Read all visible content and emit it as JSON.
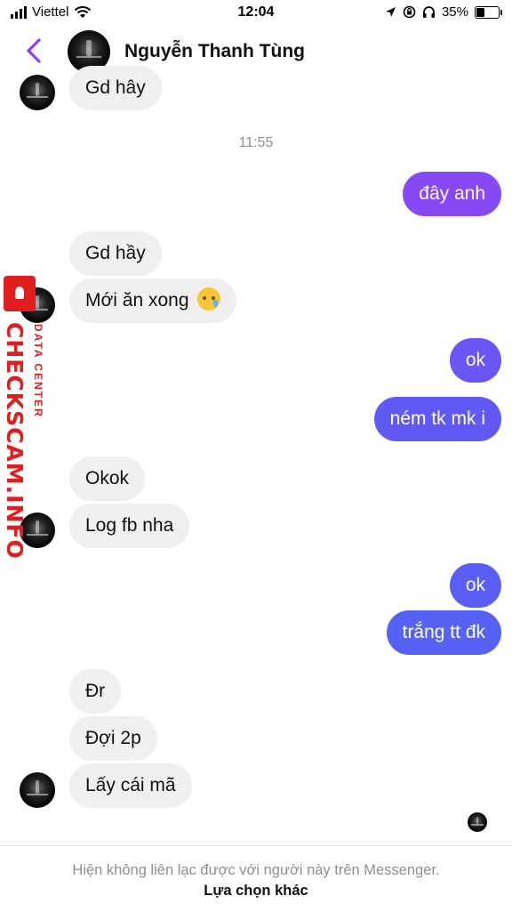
{
  "status_bar": {
    "carrier": "Viettel",
    "time": "12:04",
    "battery_percent": "35%",
    "battery_level": 0.35
  },
  "header": {
    "back_icon": "chevron-left-icon",
    "contact_name": "Nguyễn Thanh Tùng",
    "accent_color": "#8a3ffc"
  },
  "messages": [
    {
      "dir": "in",
      "text": "Gd hây"
    },
    {
      "timestamp": "11:55"
    },
    {
      "dir": "out",
      "text": "đây anh",
      "color": "#8649f3"
    },
    {
      "dir": "in",
      "text": "Gd hầy"
    },
    {
      "dir": "in",
      "text": "Mới ăn xong",
      "emoji": "crying-face-emoji"
    },
    {
      "dir": "out",
      "text": "ok",
      "color": "#6a55f5"
    },
    {
      "dir": "out",
      "text": "ném tk mk i",
      "color": "#6159f4"
    },
    {
      "dir": "in",
      "text": "Okok"
    },
    {
      "dir": "in",
      "text": "Log fb nha"
    },
    {
      "dir": "out",
      "text": "ok",
      "color": "#5b5ef5"
    },
    {
      "dir": "out",
      "text": "trắng tt đk",
      "color": "#5662f4"
    },
    {
      "dir": "in",
      "text": "Đr"
    },
    {
      "dir": "in",
      "text": "Đợi 2p"
    },
    {
      "dir": "in",
      "text": "Lấy cái mã"
    }
  ],
  "watermark": {
    "main": "CHECKSCAM.INFO",
    "sub": "DATA CENTER",
    "color": "#e01e1e"
  },
  "footer": {
    "note": "Hiện không liên lạc được với người này trên Messenger.",
    "link": "Lựa chọn khác"
  }
}
